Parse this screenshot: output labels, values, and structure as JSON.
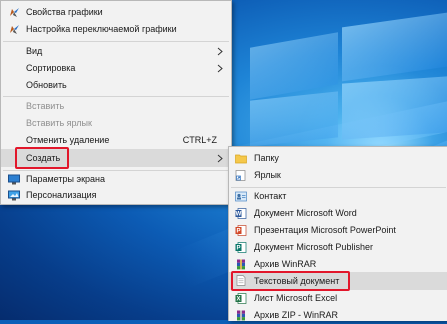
{
  "context_menu": {
    "items": [
      {
        "label": "Свойства графики",
        "icon": "intel-graphics-icon"
      },
      {
        "label": "Настройка переключаемой графики",
        "icon": "intel-graphics-icon"
      },
      {
        "label": "Вид",
        "submenu": true
      },
      {
        "label": "Сортировка",
        "submenu": true
      },
      {
        "label": "Обновить"
      },
      {
        "label": "Вставить",
        "disabled": true
      },
      {
        "label": "Вставить ярлык",
        "disabled": true
      },
      {
        "label": "Отменить удаление",
        "shortcut": "CTRL+Z"
      },
      {
        "label": "Создать",
        "submenu": true,
        "highlighted": true
      },
      {
        "label": "Параметры экрана",
        "icon": "display-settings-icon"
      },
      {
        "label": "Персонализация",
        "icon": "personalization-icon"
      }
    ]
  },
  "submenu_create": {
    "items": [
      {
        "label": "Папку",
        "icon": "folder-icon"
      },
      {
        "label": "Ярлык",
        "icon": "shortcut-icon"
      },
      {
        "label": "Контакт",
        "icon": "contact-icon"
      },
      {
        "label": "Документ Microsoft Word",
        "icon": "word-icon"
      },
      {
        "label": "Презентация Microsoft PowerPoint",
        "icon": "powerpoint-icon"
      },
      {
        "label": "Документ Microsoft Publisher",
        "icon": "publisher-icon"
      },
      {
        "label": "Архив WinRAR",
        "icon": "winrar-icon"
      },
      {
        "label": "Текстовый документ",
        "icon": "text-document-icon",
        "highlighted": true
      },
      {
        "label": "Лист Microsoft Excel",
        "icon": "excel-icon"
      },
      {
        "label": "Архив ZIP - WinRAR",
        "icon": "winrar-zip-icon"
      }
    ]
  },
  "colors": {
    "highlight_border": "#e2172b",
    "menu_bg": "#f2f2f2",
    "hover_bg": "#dadada"
  }
}
